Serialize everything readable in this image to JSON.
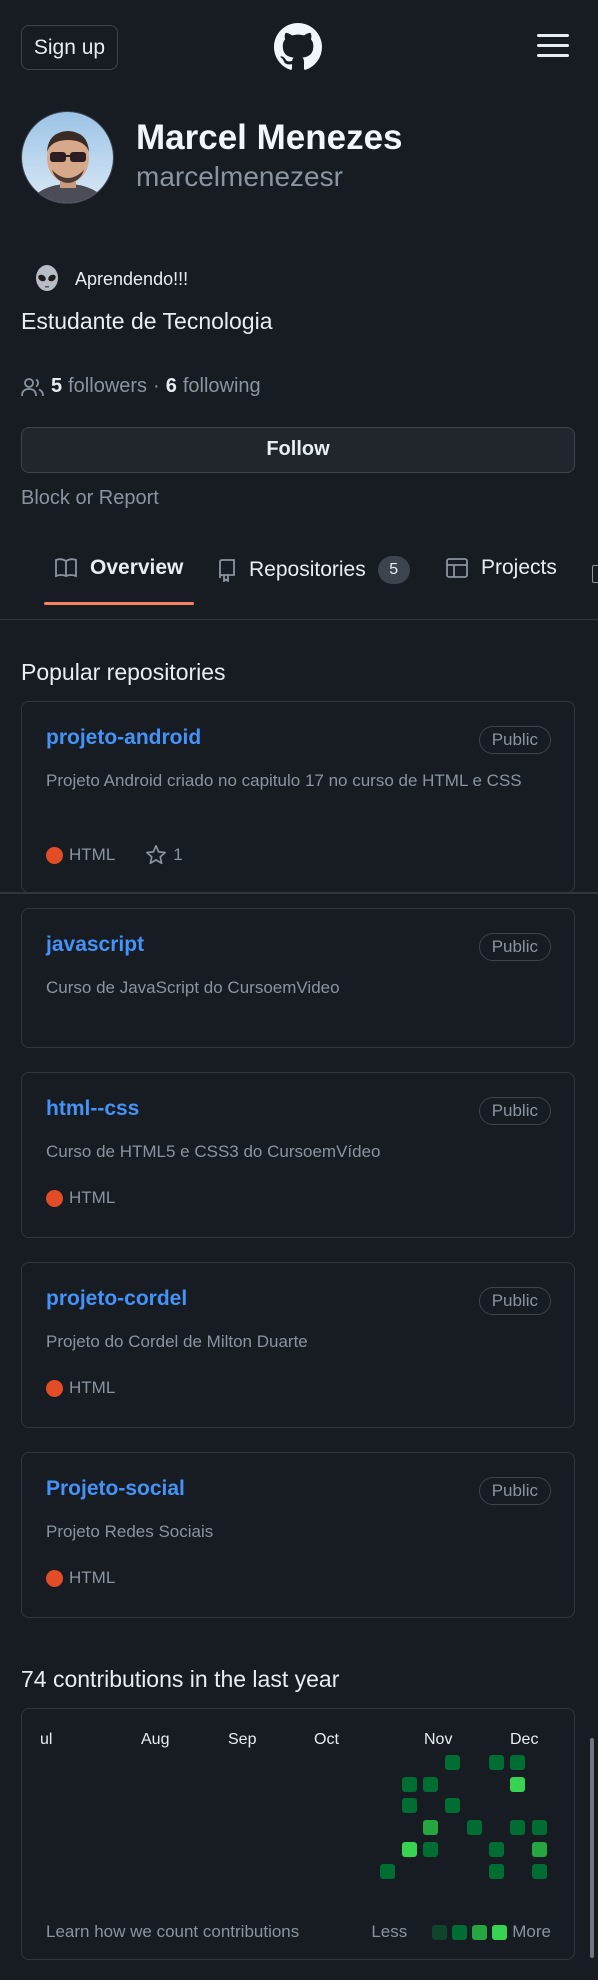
{
  "header": {
    "signup_label": "Sign up"
  },
  "profile": {
    "name": "Marcel Menezes",
    "login": "marcelmenezesr",
    "status_text": "Aprendendo!!!",
    "bio": "Estudante de Tecnologia",
    "followers_count": "5",
    "followers_label": "followers",
    "separator": "·",
    "following_count": "6",
    "following_label": "following",
    "follow_button": "Follow",
    "block_report": "Block or Report"
  },
  "tabs": [
    {
      "label": "Overview",
      "active": true
    },
    {
      "label": "Repositories",
      "counter": "5"
    },
    {
      "label": "Projects"
    }
  ],
  "popular": {
    "title": "Popular repositories",
    "repos": [
      {
        "name": "projeto-android",
        "visibility": "Public",
        "description": "Projeto Android criado no capitulo 17 no curso de HTML e CSS",
        "language": "HTML",
        "stars": "1"
      },
      {
        "name": "javascript",
        "visibility": "Public",
        "description": "Curso de JavaScript do CursoemVideo"
      },
      {
        "name": "html--css",
        "visibility": "Public",
        "description": "Curso de HTML5 e CSS3 do CursoemVídeo",
        "language": "HTML"
      },
      {
        "name": "projeto-cordel",
        "visibility": "Public",
        "description": "Projeto do Cordel de Milton Duarte",
        "language": "HTML"
      },
      {
        "name": "Projeto-social",
        "visibility": "Public",
        "description": "Projeto Redes Sociais",
        "language": "HTML"
      }
    ]
  },
  "contributions": {
    "title": "74 contributions in the last year",
    "months": [
      "ul",
      "Aug",
      "Sep",
      "Oct",
      "Nov",
      "Dec"
    ],
    "learn_link": "Learn how we count contributions",
    "legend_less": "Less",
    "legend_more": "More"
  },
  "colors": {
    "accent_tab": "#f78166",
    "link": "#4493f8",
    "html_lang": "#e34c26",
    "contrib_level1": "#0e4429",
    "contrib_level2": "#006d32",
    "contrib_level3": "#26a641",
    "contrib_level4": "#39d353"
  },
  "icons": [
    "github-logo-icon",
    "hamburger-menu-icon",
    "alien-emoji-icon",
    "people-icon",
    "book-icon",
    "repo-icon",
    "table-icon",
    "star-icon"
  ]
}
